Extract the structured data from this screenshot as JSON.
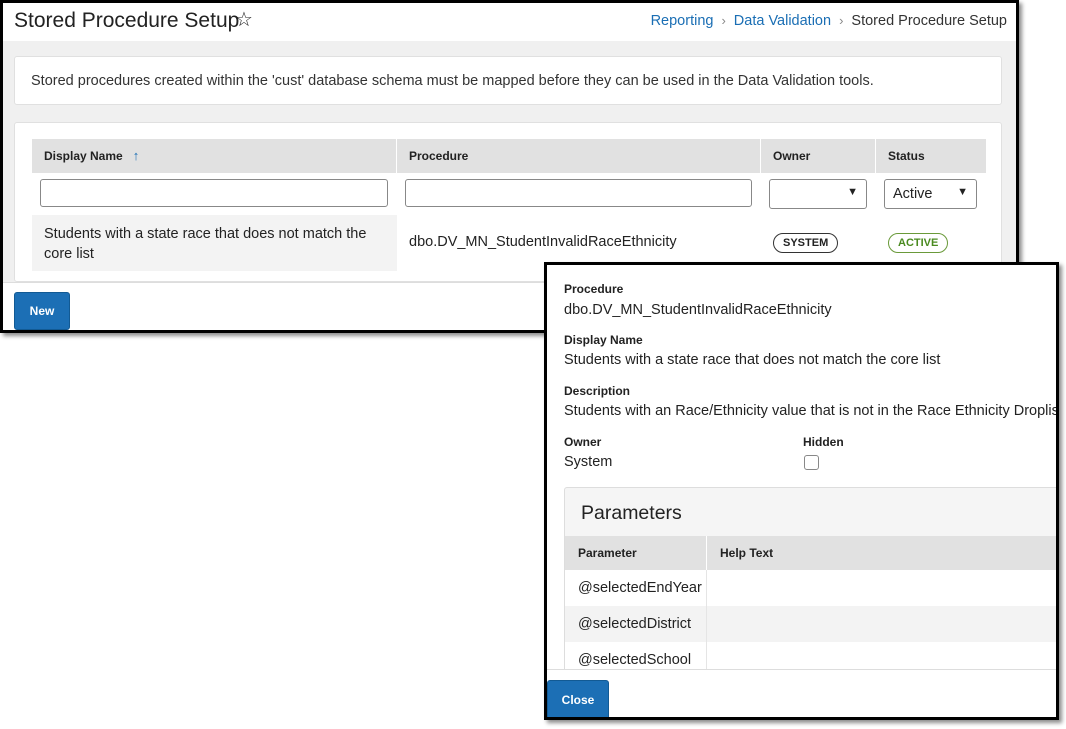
{
  "main": {
    "title": "Stored Procedure Setup",
    "breadcrumb": [
      "Reporting",
      "Data Validation",
      "Stored Procedure Setup"
    ],
    "info_text": "Stored procedures created within the 'cust' database schema must be mapped before they can be used in the Data Validation tools.",
    "columns": [
      "Display Name",
      "Procedure",
      "Owner",
      "Status"
    ],
    "filters": {
      "display_name": "",
      "procedure": "",
      "owner": "",
      "status": "Active"
    },
    "rows": [
      {
        "display_name": "Students with a state race that does not match the core list",
        "procedure": "dbo.DV_MN_StudentInvalidRaceEthnicity",
        "owner": "SYSTEM",
        "status": "ACTIVE"
      }
    ],
    "new_button": "New"
  },
  "detail": {
    "procedure_label": "Procedure",
    "procedure_value": "dbo.DV_MN_StudentInvalidRaceEthnicity",
    "display_name_label": "Display Name",
    "display_name_value": "Students with a state race that does not match the core list",
    "description_label": "Description",
    "description_value": "Students with an Race/Ethnicity value that is not in the Race Ethnicity Droplist.",
    "owner_label": "Owner",
    "owner_value": "System",
    "hidden_label": "Hidden",
    "hidden_checked": false,
    "parameters": {
      "title": "Parameters",
      "columns": [
        "Parameter",
        "Help Text"
      ],
      "rows": [
        {
          "name": "@selectedEndYear",
          "help": ""
        },
        {
          "name": "@selectedDistrict",
          "help": ""
        },
        {
          "name": "@selectedSchool",
          "help": ""
        }
      ]
    },
    "close_button": "Close"
  },
  "colors": {
    "link": "#1a6eb4",
    "primary_button": "#1c6fb5",
    "active_badge": "#4a8a20"
  },
  "icons": {
    "favorite": "star-outline-icon",
    "sort": "sort-ascending-icon",
    "breadcrumb_separator": "chevron-right-icon"
  }
}
